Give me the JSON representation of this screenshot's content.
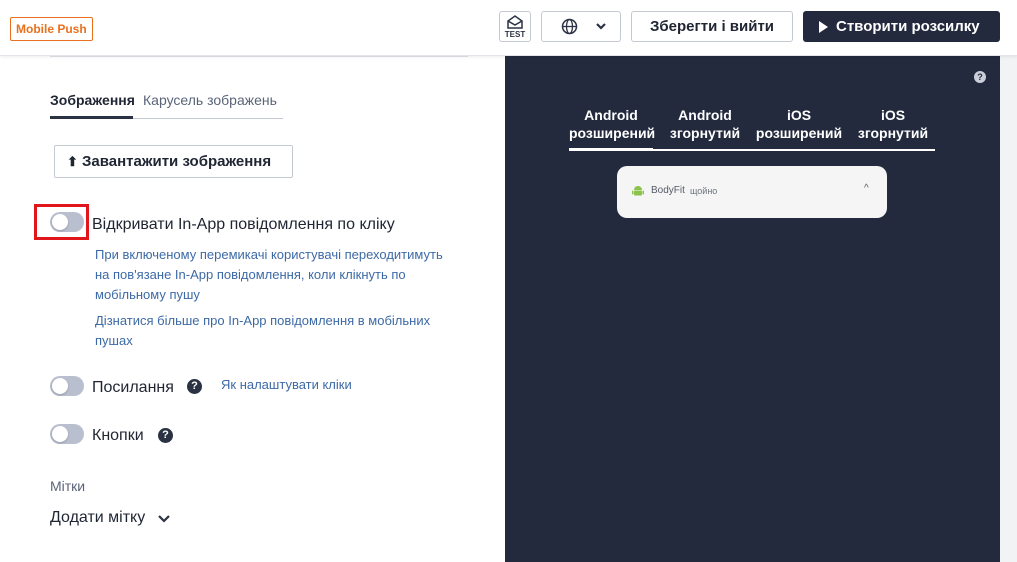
{
  "header": {
    "badge": "Mobile Push",
    "test_label": "TEST",
    "save_exit": "Зберегти і вийти",
    "create_campaign": "Створити розсилку"
  },
  "left": {
    "tabs": [
      "Зображення",
      "Карусель зображень"
    ],
    "upload_label": "Завантажити зображення",
    "upload_arrow": "⬆",
    "inapp_toggle_label": "Відкривати In-App повідомлення по кліку",
    "inapp_desc_lines": [
      "При включеному перемикачі користувачі переходитимуть",
      "на пов'язане In-App повідомлення, коли клікнуть по",
      "мобільному пушу"
    ],
    "learn_more_link": "Дізнатися більше",
    "learn_more_rest_1": " про In-App повідомлення в мобільних",
    "learn_more_rest_2": "пушах",
    "links_toggle_label": "Посилання",
    "links_help": "?",
    "clicks_link": "Як налаштувати кліки",
    "buttons_toggle_label": "Кнопки",
    "buttons_help": "?",
    "tags_label": "Мітки",
    "add_tag": "Додати мітку"
  },
  "preview": {
    "help": "?",
    "tabs": [
      {
        "line1": "Android",
        "line2": "розширений"
      },
      {
        "line1": "Android",
        "line2": "згорнутий"
      },
      {
        "line1": "iOS",
        "line2": "розширений"
      },
      {
        "line1": "iOS",
        "line2": "згорнутий"
      }
    ],
    "notification": {
      "app_name": "BodyFit",
      "time": "щойно",
      "caret": "^"
    }
  },
  "colors": {
    "accent_orange": "#e8711f",
    "dark_navy": "#232a3d",
    "link_blue": "#3d6aa6",
    "highlight_red": "#e0161b",
    "toggle_off": "#b9bfcf"
  }
}
